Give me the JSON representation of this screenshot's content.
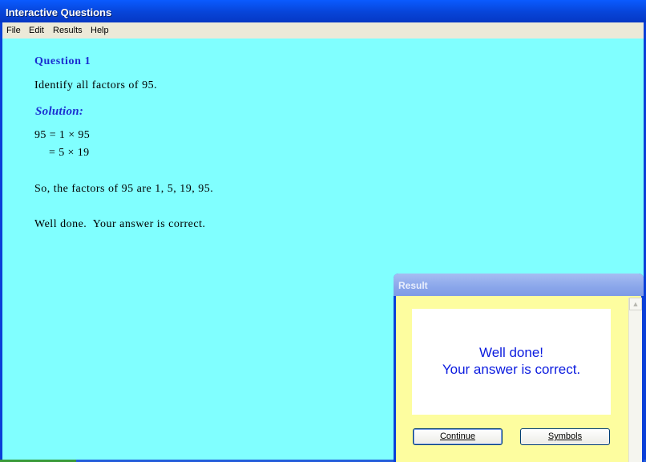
{
  "window": {
    "title": "Interactive Questions"
  },
  "menu": {
    "items": [
      "File",
      "Edit",
      "Results",
      "Help"
    ]
  },
  "question": {
    "heading": "Question 1",
    "text": "Identify all factors of 95.",
    "solution_heading": "Solution:",
    "equation_line1": "95 = 1 × 95",
    "equation_line2": "= 5 × 19",
    "conclusion": "So, the factors of 95 are 1, 5, 19, 95.",
    "feedback": "Well done.  Your answer is correct."
  },
  "dialog": {
    "title": "Result",
    "message_line1": "Well done!",
    "message_line2": "Your answer is correct.",
    "continue_label": "Continue",
    "symbols_label": "Symbols"
  }
}
